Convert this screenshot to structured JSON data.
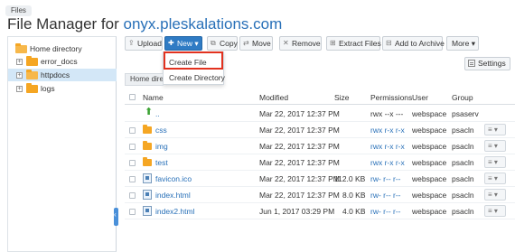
{
  "breadcrumb": "Files",
  "title": {
    "prefix": "File Manager for ",
    "host": "onyx.pleskalations.com"
  },
  "sidebar": {
    "items": [
      {
        "label": "Home directory"
      },
      {
        "label": "error_docs"
      },
      {
        "label": "httpdocs"
      },
      {
        "label": "logs"
      }
    ]
  },
  "toolbar": {
    "upload": "Upload",
    "new": "New",
    "copy": "Copy",
    "move": "Move",
    "remove": "Remove",
    "extract": "Extract Files",
    "archive": "Add to Archive",
    "more": "More"
  },
  "new_menu": {
    "create_file": "Create File",
    "create_directory": "Create Directory"
  },
  "settings_label": "Settings",
  "path": "Home directory",
  "columns": {
    "name": "Name",
    "modified": "Modified",
    "size": "Size",
    "permissions": "Permissions",
    "user": "User",
    "group": "Group"
  },
  "files": [
    {
      "name": "..",
      "modified": "Mar 22, 2017 12:37 PM",
      "size": "",
      "permissions": "rwx --x ---",
      "user": "webspace",
      "group": "psaserv",
      "type": "up"
    },
    {
      "name": "css",
      "modified": "Mar 22, 2017 12:37 PM",
      "size": "",
      "permissions": "rwx r-x r-x",
      "user": "webspace",
      "group": "psacln",
      "type": "folder"
    },
    {
      "name": "img",
      "modified": "Mar 22, 2017 12:37 PM",
      "size": "",
      "permissions": "rwx r-x r-x",
      "user": "webspace",
      "group": "psacln",
      "type": "folder"
    },
    {
      "name": "test",
      "modified": "Mar 22, 2017 12:37 PM",
      "size": "",
      "permissions": "rwx r-x r-x",
      "user": "webspace",
      "group": "psacln",
      "type": "folder"
    },
    {
      "name": "favicon.ico",
      "modified": "Mar 22, 2017 12:37 PM",
      "size": "112.0 KB",
      "permissions": "rw- r-- r--",
      "user": "webspace",
      "group": "psacln",
      "type": "file"
    },
    {
      "name": "index.html",
      "modified": "Mar 22, 2017 12:37 PM",
      "size": "8.0 KB",
      "permissions": "rw- r-- r--",
      "user": "webspace",
      "group": "psacln",
      "type": "file"
    },
    {
      "name": "index2.html",
      "modified": "Jun 1, 2017 03:29 PM",
      "size": "4.0 KB",
      "permissions": "rw- r-- r--",
      "user": "webspace",
      "group": "psacln",
      "type": "file"
    }
  ],
  "colors": {
    "accent": "#2f7bc4",
    "link": "#2870b8",
    "highlight": "#e2321f",
    "folder": "#f5a623",
    "selected": "#d3e7f7"
  }
}
